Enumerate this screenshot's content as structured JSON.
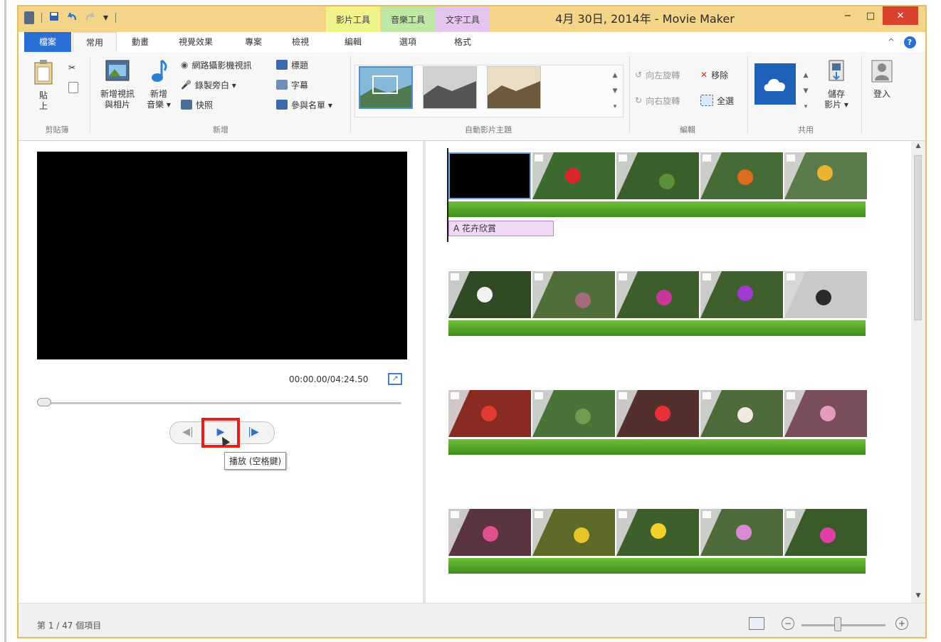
{
  "window": {
    "title": "4月 30日, 2014年 - Movie Maker",
    "minimize": "−",
    "maximize": "□",
    "close": "✕"
  },
  "quick_access": {
    "save_icon": "save-icon",
    "undo_icon": "undo-icon",
    "redo_icon": "redo-icon",
    "dropdown": "▾"
  },
  "tool_tabs": [
    {
      "label": "影片工具",
      "color": "#f0f28a"
    },
    {
      "label": "音樂工具",
      "color": "#bfe8a6"
    },
    {
      "label": "文字工具",
      "color": "#e6c6f0"
    }
  ],
  "tabs": [
    "檔案",
    "常用",
    "動畫",
    "視覺效果",
    "專案",
    "檢視",
    "編輯",
    "選項",
    "格式"
  ],
  "ribbon_help": "?",
  "ribbon_collapse": "^",
  "ribbon": {
    "clipboard": {
      "paste": "貼\n上",
      "label": "剪貼簿"
    },
    "add": {
      "add_video": "新增視訊\n與相片",
      "add_music": "新增\n音樂 ▾",
      "webcam": "網路攝影機視訊",
      "narration": "錄製旁白 ▾",
      "snapshot": "快照",
      "title": "標題",
      "caption": "字幕",
      "credits": "參與名單 ▾",
      "label": "新增"
    },
    "themes": {
      "label": "自動影片主題"
    },
    "editing": {
      "rotate_left": "向左旋轉",
      "rotate_right": "向右旋轉",
      "remove": "移除",
      "select_all": "全選",
      "label": "編輯"
    },
    "share": {
      "save_movie": "儲存\n影片 ▾",
      "label": "共用"
    },
    "signin": "登入"
  },
  "preview": {
    "timecode": "00:00.00/04:24.50",
    "tooltip": "播放 (空格鍵)",
    "play_icon": "▶",
    "prev_icon": "◀|",
    "next_icon": "|▶"
  },
  "storyboard": {
    "caption_text": "A 花卉欣賞"
  },
  "status": {
    "text": "第 1 / 47 個項目",
    "zoom_out": "−",
    "zoom_in": "+"
  },
  "colors": {
    "title_bar": "#f4d488",
    "file_tab": "#2a6fd4",
    "highlight": "#e0221b",
    "audio_track": "#4f9c25"
  }
}
